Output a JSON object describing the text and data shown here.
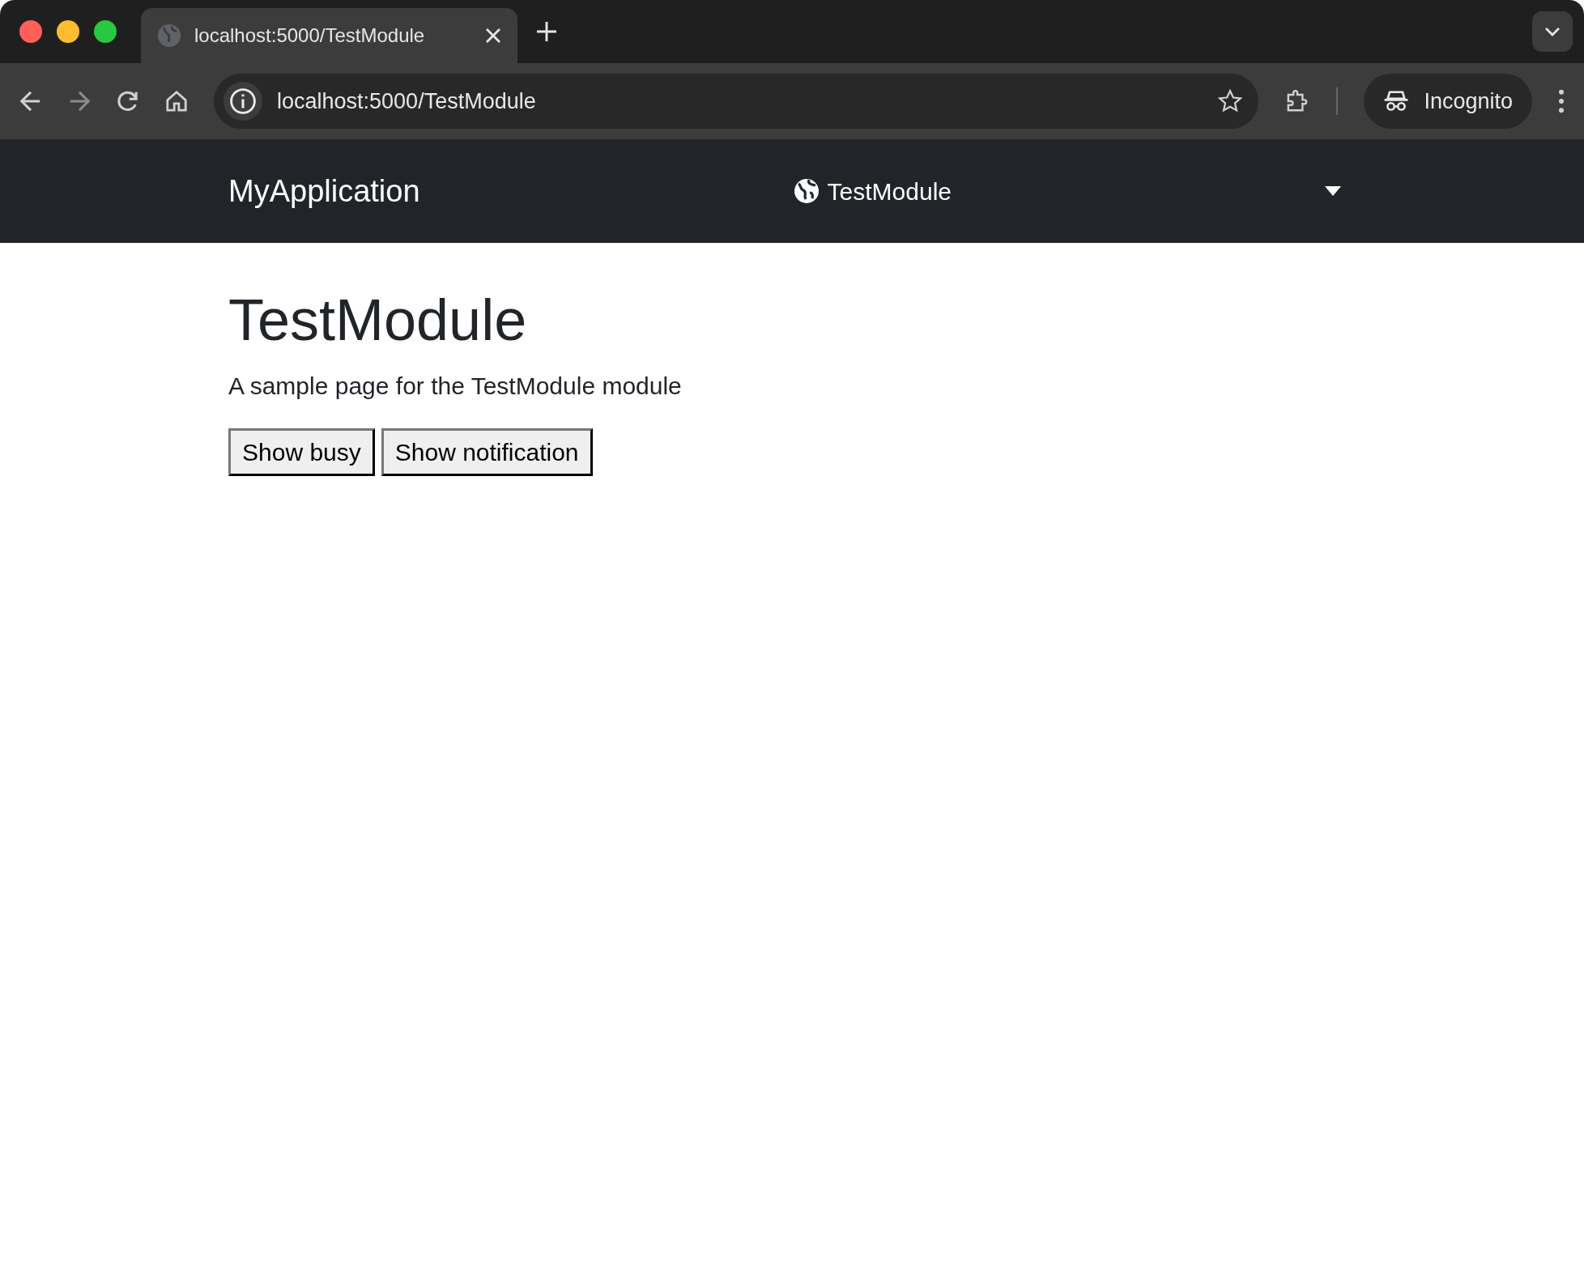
{
  "browser": {
    "tab_title": "localhost:5000/TestModule",
    "address": "localhost:5000/TestModule",
    "profile": "Incognito"
  },
  "navbar": {
    "brand": "MyApplication",
    "module": "TestModule"
  },
  "page": {
    "title": "TestModule",
    "description": "A sample page for the TestModule module",
    "buttons": [
      {
        "label": "Show busy"
      },
      {
        "label": "Show notification"
      }
    ]
  }
}
